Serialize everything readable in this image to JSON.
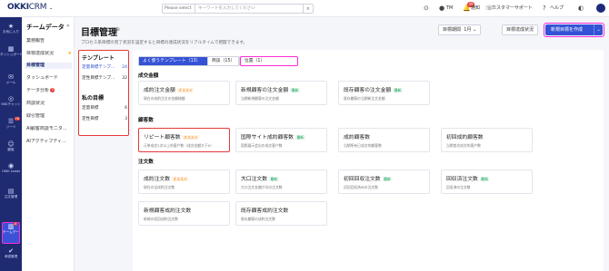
{
  "app": {
    "logo_main": "OKKI",
    "logo_sub": "CRM",
    "logo_chevron": "⌄"
  },
  "topbar": {
    "search_select": "Please select",
    "search_placeholder": "キーワードを入力してください",
    "user_initials": "TM",
    "notify_label": "通知",
    "notify_count": "49",
    "support_label": "カスタマーサポート",
    "help_label": "ヘルプ"
  },
  "rail": {
    "items": [
      {
        "label": "お気に入り",
        "icon": "★"
      },
      {
        "label": "ダッシュボード",
        "icon": "▦"
      },
      {
        "label": "メール",
        "icon": "✉"
      },
      {
        "label": "SNSチャット",
        "icon": "◎"
      },
      {
        "label": "リード",
        "icon": "☰",
        "badge": "78"
      },
      {
        "label": "顧客",
        "icon": "👤"
      },
      {
        "label": "OKKI Leads",
        "icon": "◉"
      },
      {
        "label": "注文管理",
        "icon": "▤"
      },
      {
        "label": "チームデータ",
        "icon": "▥",
        "badge": "4"
      },
      {
        "label": "承認管理",
        "icon": "✔"
      }
    ]
  },
  "sidebar": {
    "title": "チームデータ",
    "collapse_icon": "«",
    "items": [
      {
        "label": "業務報告"
      },
      {
        "label": "目標達成状況",
        "star": "★"
      },
      {
        "label": "目標管理"
      },
      {
        "label": "ダッシュボード"
      },
      {
        "label": "データ分析",
        "dot": "3"
      },
      {
        "label": "商談状況"
      },
      {
        "label": "取引管理"
      },
      {
        "label": "AI顧客商談モニタ..."
      },
      {
        "label": "AIアクティブティ..."
      }
    ]
  },
  "header": {
    "title": "目標管理",
    "title_icon": "⊕",
    "subtitle": "プロセス系目標の完了状況を設定すると目標の達成状況をリアルタイムで把握できます。",
    "period_label": "目標期間",
    "period_value": "1月",
    "period_chevron": "⌄",
    "status_button": "目標達成状況",
    "create_button": "新規目標を作成",
    "create_chevron": "⌄"
  },
  "templates": {
    "heading": "テンプレート",
    "items": [
      {
        "label": "定量目標テンプ...",
        "count": "24"
      },
      {
        "label": "定性目標テンプ...",
        "count": "32"
      }
    ],
    "my_heading": "私の目標",
    "my_items": [
      {
        "label": "定量目標",
        "count": "6"
      },
      {
        "label": "定性目標",
        "count": "3"
      }
    ]
  },
  "tabs": [
    {
      "label": "よく使うテンプレート（13）"
    },
    {
      "label": "商談（15）"
    },
    {
      "label": "位置（1）"
    }
  ],
  "sections": [
    {
      "title": "成交金額",
      "cards": [
        {
          "title": "成約注文金額",
          "tag": "オススメ",
          "tag_type": "rec",
          "desc": "現在の成約注文の金額総額"
        },
        {
          "title": "新規顧客の注文金額",
          "tag": "最新",
          "tag_type": "new",
          "desc": "当期新規顧客の注文金額"
        },
        {
          "title": "既存顧客の注文金額",
          "tag": "最新",
          "tag_type": "new",
          "desc": "既存顧客の当期新注文金額"
        }
      ]
    },
    {
      "title": "顧客数",
      "cards": [
        {
          "title": "リピート顧客数",
          "tag": "オススメ",
          "tag_type": "rec",
          "desc": "订单成交2次以上的客户数（成交金额大于0）"
        },
        {
          "title": "国際サイト成約顧客数",
          "tag": "最新",
          "tag_type": "new",
          "desc": "国際展示会出の成交客户数"
        },
        {
          "title": "成約顧客数",
          "tag": "",
          "tag_type": "",
          "desc": "当期所有已成交的顧客数"
        },
        {
          "title": "初回成約顧客数",
          "tag": "",
          "tag_type": "",
          "desc": "当期首次成交的客户数"
        }
      ]
    },
    {
      "title": "注文数",
      "cards": [
        {
          "title": "成約注文数",
          "tag": "オススメ",
          "tag_type": "rec",
          "desc": "現在の全成約注文数"
        },
        {
          "title": "大口注文数",
          "tag": "最新",
          "tag_type": "new",
          "desc": "大口注文金額が次の注文数"
        },
        {
          "title": "初回回収注文数",
          "tag": "最新",
          "tag_type": "new",
          "desc": "初回回収済みの注文数"
        },
        {
          "title": "回収済注文数",
          "tag": "最新",
          "tag_type": "new",
          "desc": "回収済の注文数"
        },
        {
          "title": "新規顧客成約注文数",
          "tag": "",
          "tag_type": "",
          "desc": "新規の初回成約注文数"
        },
        {
          "title": "既存顧客成約注文数",
          "tag": "",
          "tag_type": "",
          "desc": "既存顧客の成約注文数"
        }
      ]
    }
  ]
}
